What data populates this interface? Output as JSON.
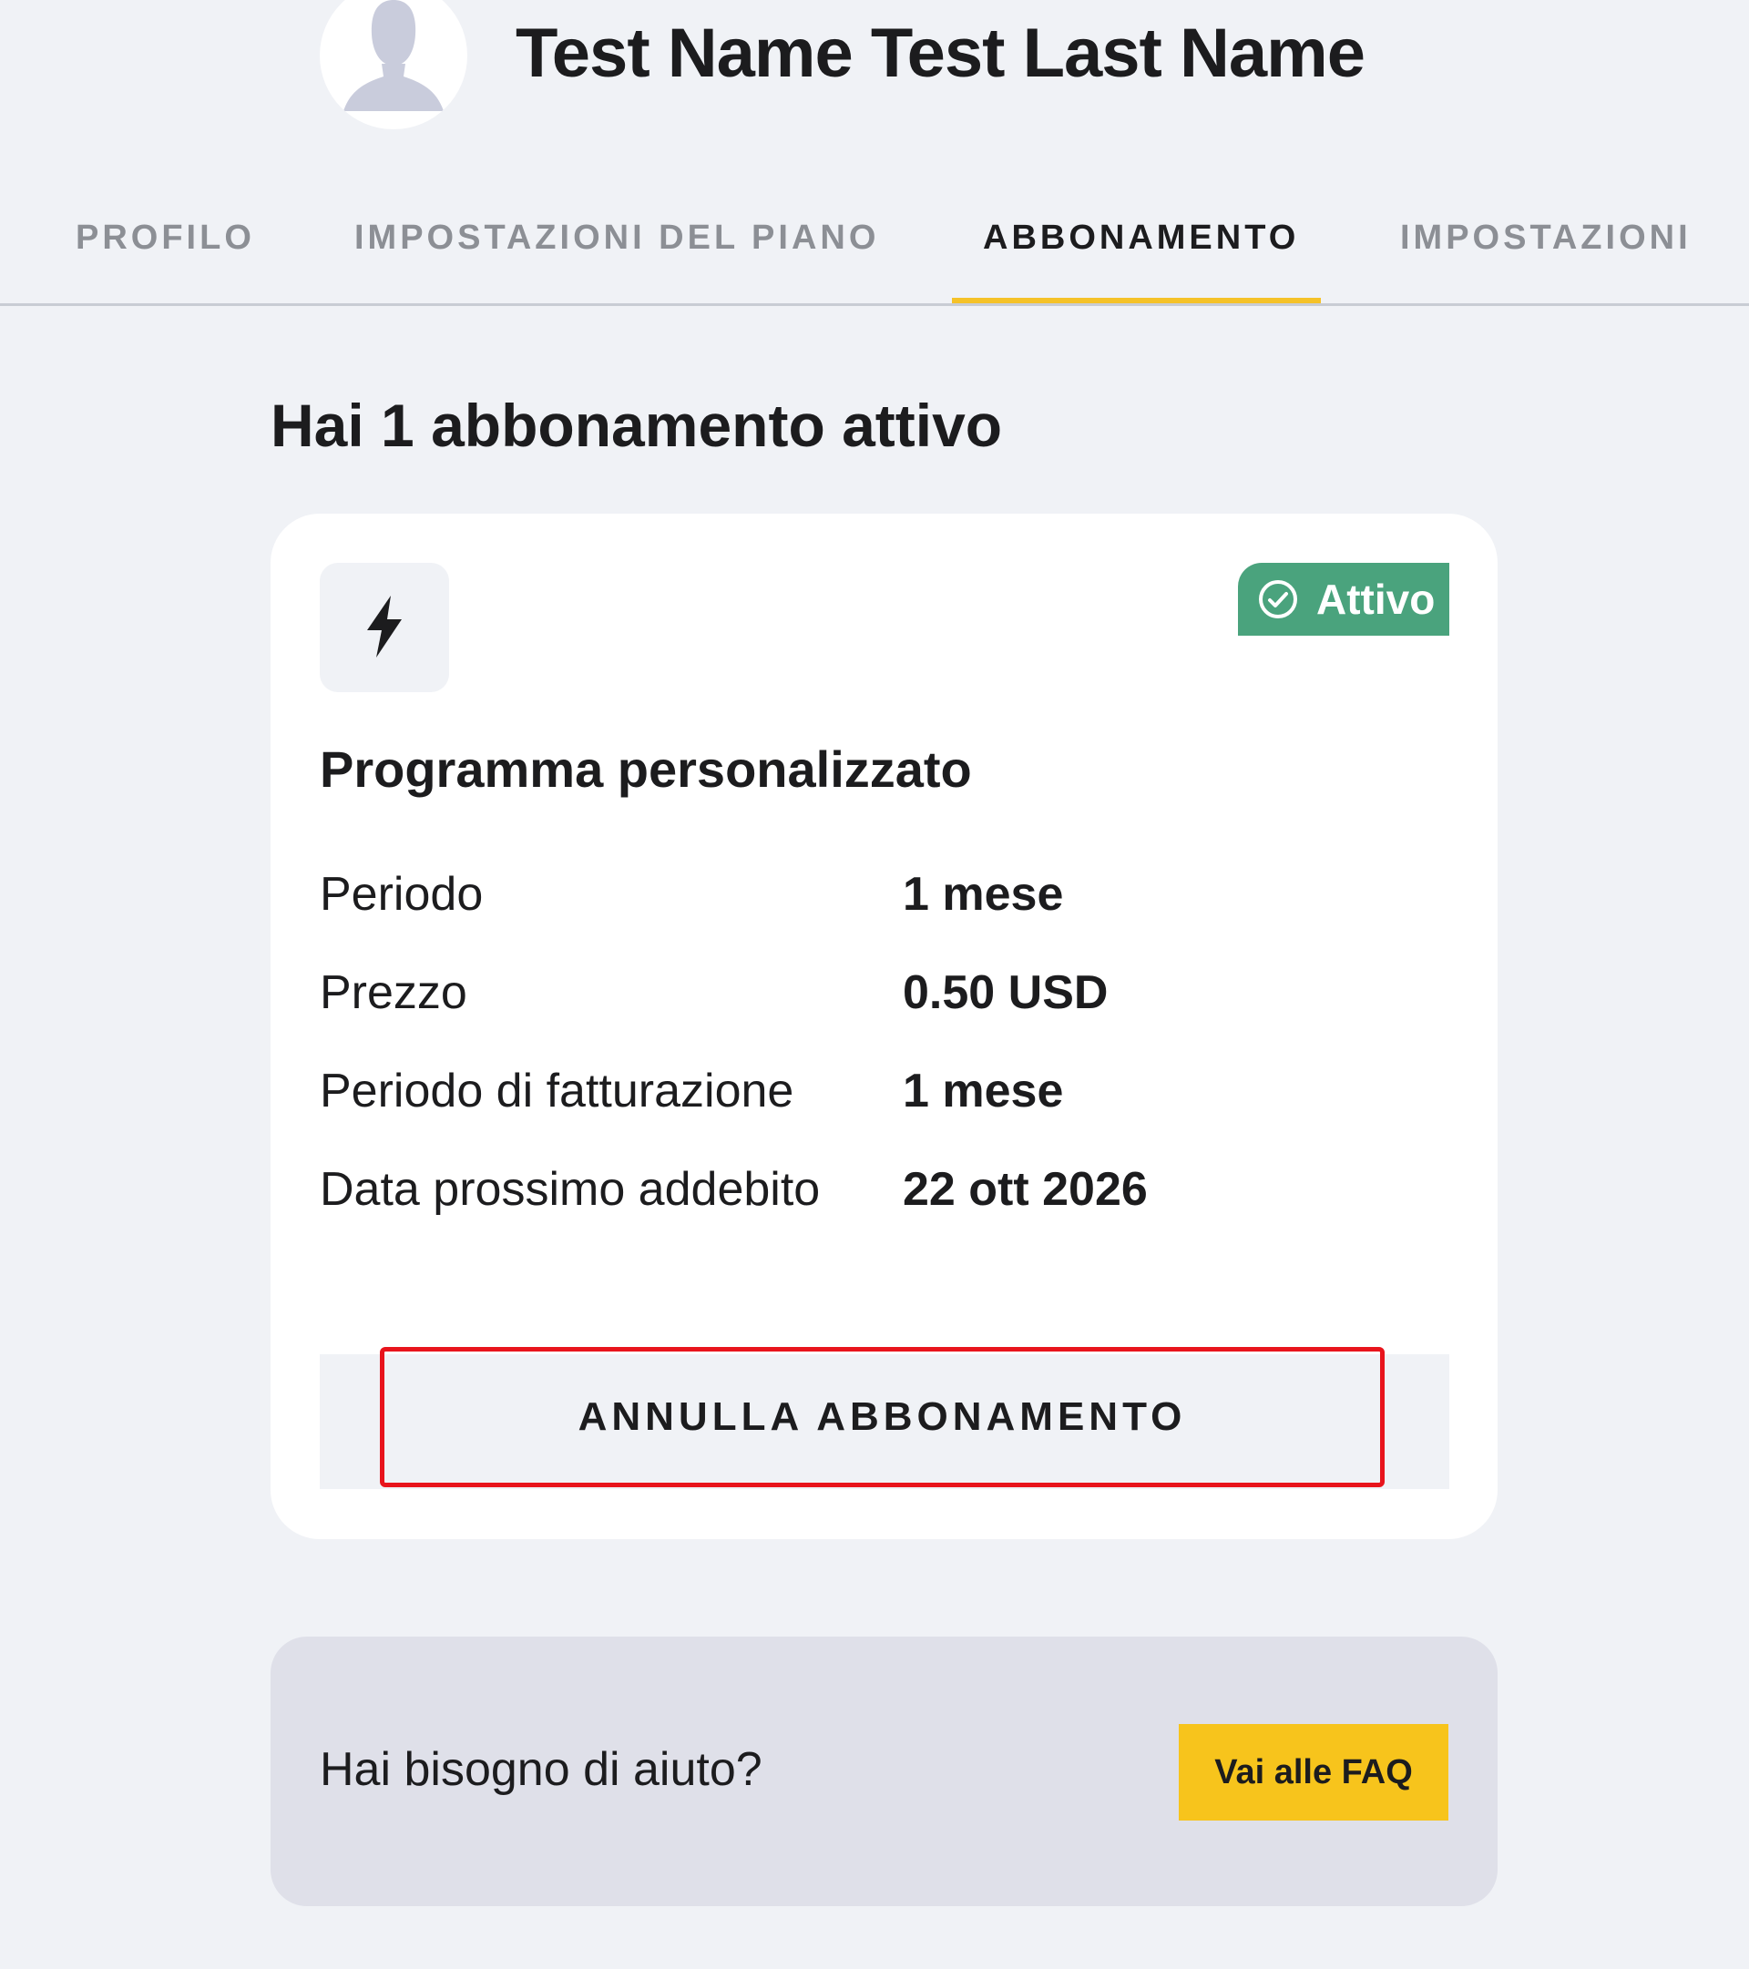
{
  "header": {
    "user_name": "Test Name Test Last Name",
    "avatar_icon": "user-silhouette-icon"
  },
  "tabs": [
    {
      "label": "PROFILO",
      "active": false
    },
    {
      "label": "IMPOSTAZIONI DEL PIANO",
      "active": false
    },
    {
      "label": "ABBONAMENTO",
      "active": true
    },
    {
      "label": "IMPOSTAZIONI",
      "active": false
    }
  ],
  "colors": {
    "background": "#f0f2f6",
    "accent": "#f5c228",
    "status_active": "#4aa37d",
    "faq_button": "#f7c41c",
    "highlight_border": "#e8141c"
  },
  "main": {
    "title": "Hai 1 abbonamento attivo"
  },
  "subscription": {
    "icon": "lightning-bolt-icon",
    "status": "Attivo",
    "status_icon": "check-circle-icon",
    "plan_name": "Programma personalizzato",
    "details": [
      {
        "label": "Periodo",
        "value": "1 mese"
      },
      {
        "label": "Prezzo",
        "value": "0.50 USD"
      },
      {
        "label": "Periodo di fatturazione",
        "value": "1 mese"
      },
      {
        "label": "Data prossimo addebito",
        "value": "22 ott 2026"
      }
    ],
    "cancel_label": "ANNULLA ABBONAMENTO"
  },
  "help": {
    "text": "Hai bisogno di aiuto?",
    "button_label": "Vai alle FAQ"
  }
}
